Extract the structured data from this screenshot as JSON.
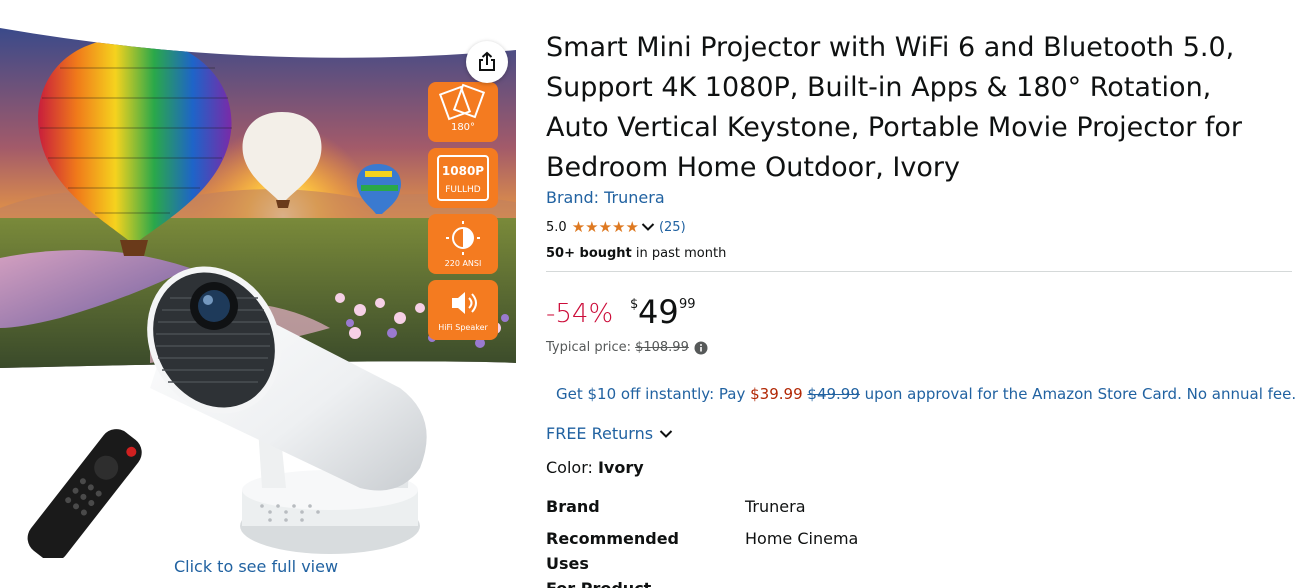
{
  "image_panel": {
    "image_alt": "Smart Mini Projector product photo with hot air balloons, remote control and feature badges",
    "share_icon": "share-icon",
    "click_full_view": "Click to see full view",
    "badges": [
      {
        "icon": "rotation-180-icon",
        "text": "180°"
      },
      {
        "icon": "1080p-fullhd-icon",
        "text_line1": "1080P",
        "text_line2": "FULLHD"
      },
      {
        "icon": "brightness-icon",
        "text": "220 ANSI"
      },
      {
        "icon": "speaker-icon",
        "text": "HiFi Speaker"
      }
    ]
  },
  "product": {
    "title_line1": "Smart Mini Projector with WiFi 6 and Bluetooth 5.0,",
    "title_line2": "Support 4K 1080P, Built-in Apps & 180° Rotation,",
    "title_line3": "Auto Vertical Keystone, Portable Movie Projector for",
    "title_line4": "Bedroom Home Outdoor, Ivory",
    "brand_link": "Brand: Trunera",
    "rating_value": "5.0",
    "review_count": "(25)",
    "bought_strong": "50+ bought",
    "bought_rest": " in past month"
  },
  "price": {
    "discount": "-54%",
    "currency": "$",
    "whole": "49",
    "fraction": "99",
    "typical_label": "Typical price:",
    "typical_value": "$108.99"
  },
  "promo": {
    "prefix": "Get $10 off instantly: Pay ",
    "new_price": "$39.99",
    "old_price": "$49.99",
    "suffix": " upon approval for the Amazon Store Card. No annual fee."
  },
  "returns": {
    "label": "FREE Returns"
  },
  "color": {
    "label": "Color: ",
    "value": "Ivory"
  },
  "specs": [
    {
      "key": "Brand",
      "value": "Trunera"
    },
    {
      "key_line1": "Recommended Uses",
      "key_line2": "For Product",
      "value": "Home Cinema"
    }
  ],
  "colors": {
    "link": "#2162a1",
    "discount": "#cc0c39",
    "star": "#de7921",
    "badge": "#f47b20",
    "promo_price": "#b12704"
  }
}
